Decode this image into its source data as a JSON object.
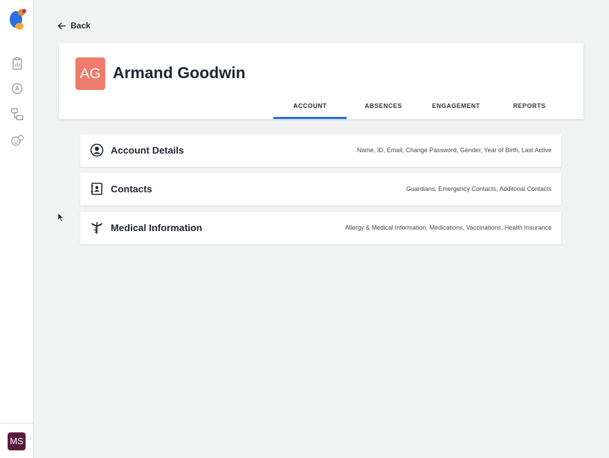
{
  "sidebar": {
    "logo_icon": "bird-logo-icon",
    "nav_icons": [
      "clipboard-icon",
      "badge-a-icon",
      "flow-icon",
      "emoji-icon"
    ],
    "user_initials": "MS",
    "user_avatar_color": "#5a1a3e"
  },
  "header": {
    "back_label": "Back"
  },
  "profile": {
    "initials": "AG",
    "name": "Armand Goodwin",
    "avatar_color": "#ef7b6c",
    "tabs": [
      {
        "label": "ACCOUNT",
        "active": true
      },
      {
        "label": "ABSENCES",
        "active": false
      },
      {
        "label": "ENGAGEMENT",
        "active": false
      },
      {
        "label": "REPORTS",
        "active": false
      }
    ],
    "accent_color": "#1e6fe0"
  },
  "sections": [
    {
      "icon": "account-circle-icon",
      "title": "Account Details",
      "description": "Name, ID, Email, Change Password, Gender, Year of Birth, Last Active"
    },
    {
      "icon": "contact-book-icon",
      "title": "Contacts",
      "description": "Guardians, Emergency Contacts, Additonal Contacts"
    },
    {
      "icon": "medical-caduceus-icon",
      "title": "Medical Information",
      "description": "Allergy & Medical Information, Medications, Vaccinations, Health Insurance"
    }
  ]
}
